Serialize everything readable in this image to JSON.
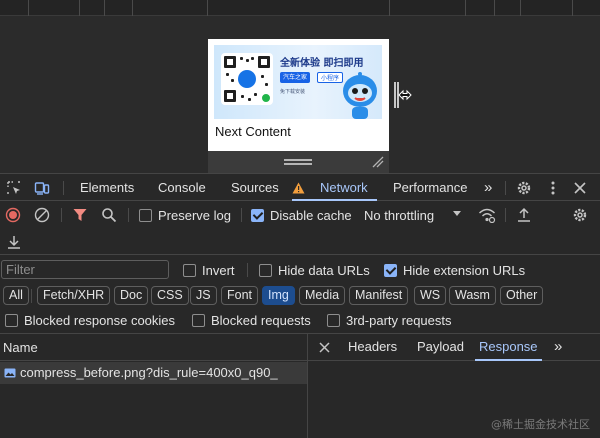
{
  "preview": {
    "ad_title": "全新体验  即扫即用",
    "ad_brand": "汽车之家",
    "ad_mini": "小程序",
    "ad_sub": "免下载安装",
    "next_content": "Next Content"
  },
  "devtools_tabs": [
    {
      "label": "Elements"
    },
    {
      "label": "Console"
    },
    {
      "label": "Sources"
    },
    {
      "label": "Network",
      "active": true,
      "warning": true
    },
    {
      "label": "Performance"
    }
  ],
  "toolbar": {
    "preserve_log": {
      "label": "Preserve log",
      "checked": false
    },
    "disable_cache": {
      "label": "Disable cache",
      "checked": true
    },
    "throttling": "No throttling"
  },
  "filter": {
    "placeholder": "Filter",
    "invert": {
      "label": "Invert",
      "checked": false
    },
    "hide_data_urls": {
      "label": "Hide data URLs",
      "checked": false
    },
    "hide_extension_urls": {
      "label": "Hide extension URLs",
      "checked": true
    }
  },
  "type_filters": [
    "All",
    "Fetch/XHR",
    "Doc",
    "CSS",
    "JS",
    "Font",
    "Img",
    "Media",
    "Manifest",
    "WS",
    "Wasm",
    "Other"
  ],
  "active_type_filter": "Img",
  "blocked": {
    "response_cookies": {
      "label": "Blocked response cookies",
      "checked": false
    },
    "requests": {
      "label": "Blocked requests",
      "checked": false
    },
    "third_party": {
      "label": "3rd-party requests",
      "checked": false
    }
  },
  "requests": {
    "column_name": "Name",
    "rows": [
      {
        "name": "compress_before.png?dis_rule=400x0_q90_"
      }
    ]
  },
  "detail_tabs": [
    {
      "label": "Headers"
    },
    {
      "label": "Payload"
    },
    {
      "label": "Response",
      "active": true
    }
  ],
  "watermark": "@稀土掘金技术社区",
  "colors": {
    "accent": "#a8c7fa",
    "record_red": "#e46962",
    "filter_red": "#f28b82",
    "warning_orange": "#f29e3d",
    "panel_bg": "#282828"
  }
}
